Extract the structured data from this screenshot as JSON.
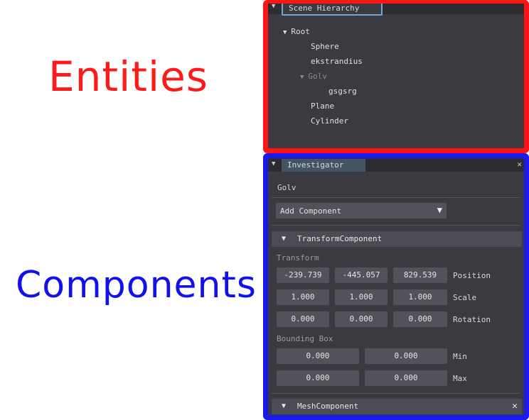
{
  "annotations": {
    "entities": "Entities",
    "components": "Components"
  },
  "hierarchy": {
    "title": "Scene Hierarchy",
    "items": [
      {
        "label": "Root"
      },
      {
        "label": "Sphere"
      },
      {
        "label": "ekstrandius"
      },
      {
        "label": "Golv"
      },
      {
        "label": "gsgsrg"
      },
      {
        "label": "Plane"
      },
      {
        "label": "Cylinder"
      }
    ]
  },
  "inspector": {
    "title": "Investigator",
    "entity_name": "Golv",
    "add_component": "Add Component",
    "transform_header": "TransformComponent",
    "transform_label": "Transform",
    "position": {
      "label": "Position",
      "x": "-239.739",
      "y": "-445.057",
      "z": "829.539"
    },
    "scale": {
      "label": "Scale",
      "x": "1.000",
      "y": "1.000",
      "z": "1.000"
    },
    "rotation": {
      "label": "Rotation",
      "x": "0.000",
      "y": "0.000",
      "z": "0.000"
    },
    "bbox_label": "Bounding Box",
    "min": {
      "label": "Min",
      "a": "0.000",
      "b": "0.000"
    },
    "max": {
      "label": "Max",
      "a": "0.000",
      "b": "0.000"
    },
    "mesh_header": "MeshComponent"
  },
  "colors": {
    "red_outline": "#ff1414",
    "blue_outline": "#1a1aee",
    "panel_bg": "#3a3a40"
  }
}
